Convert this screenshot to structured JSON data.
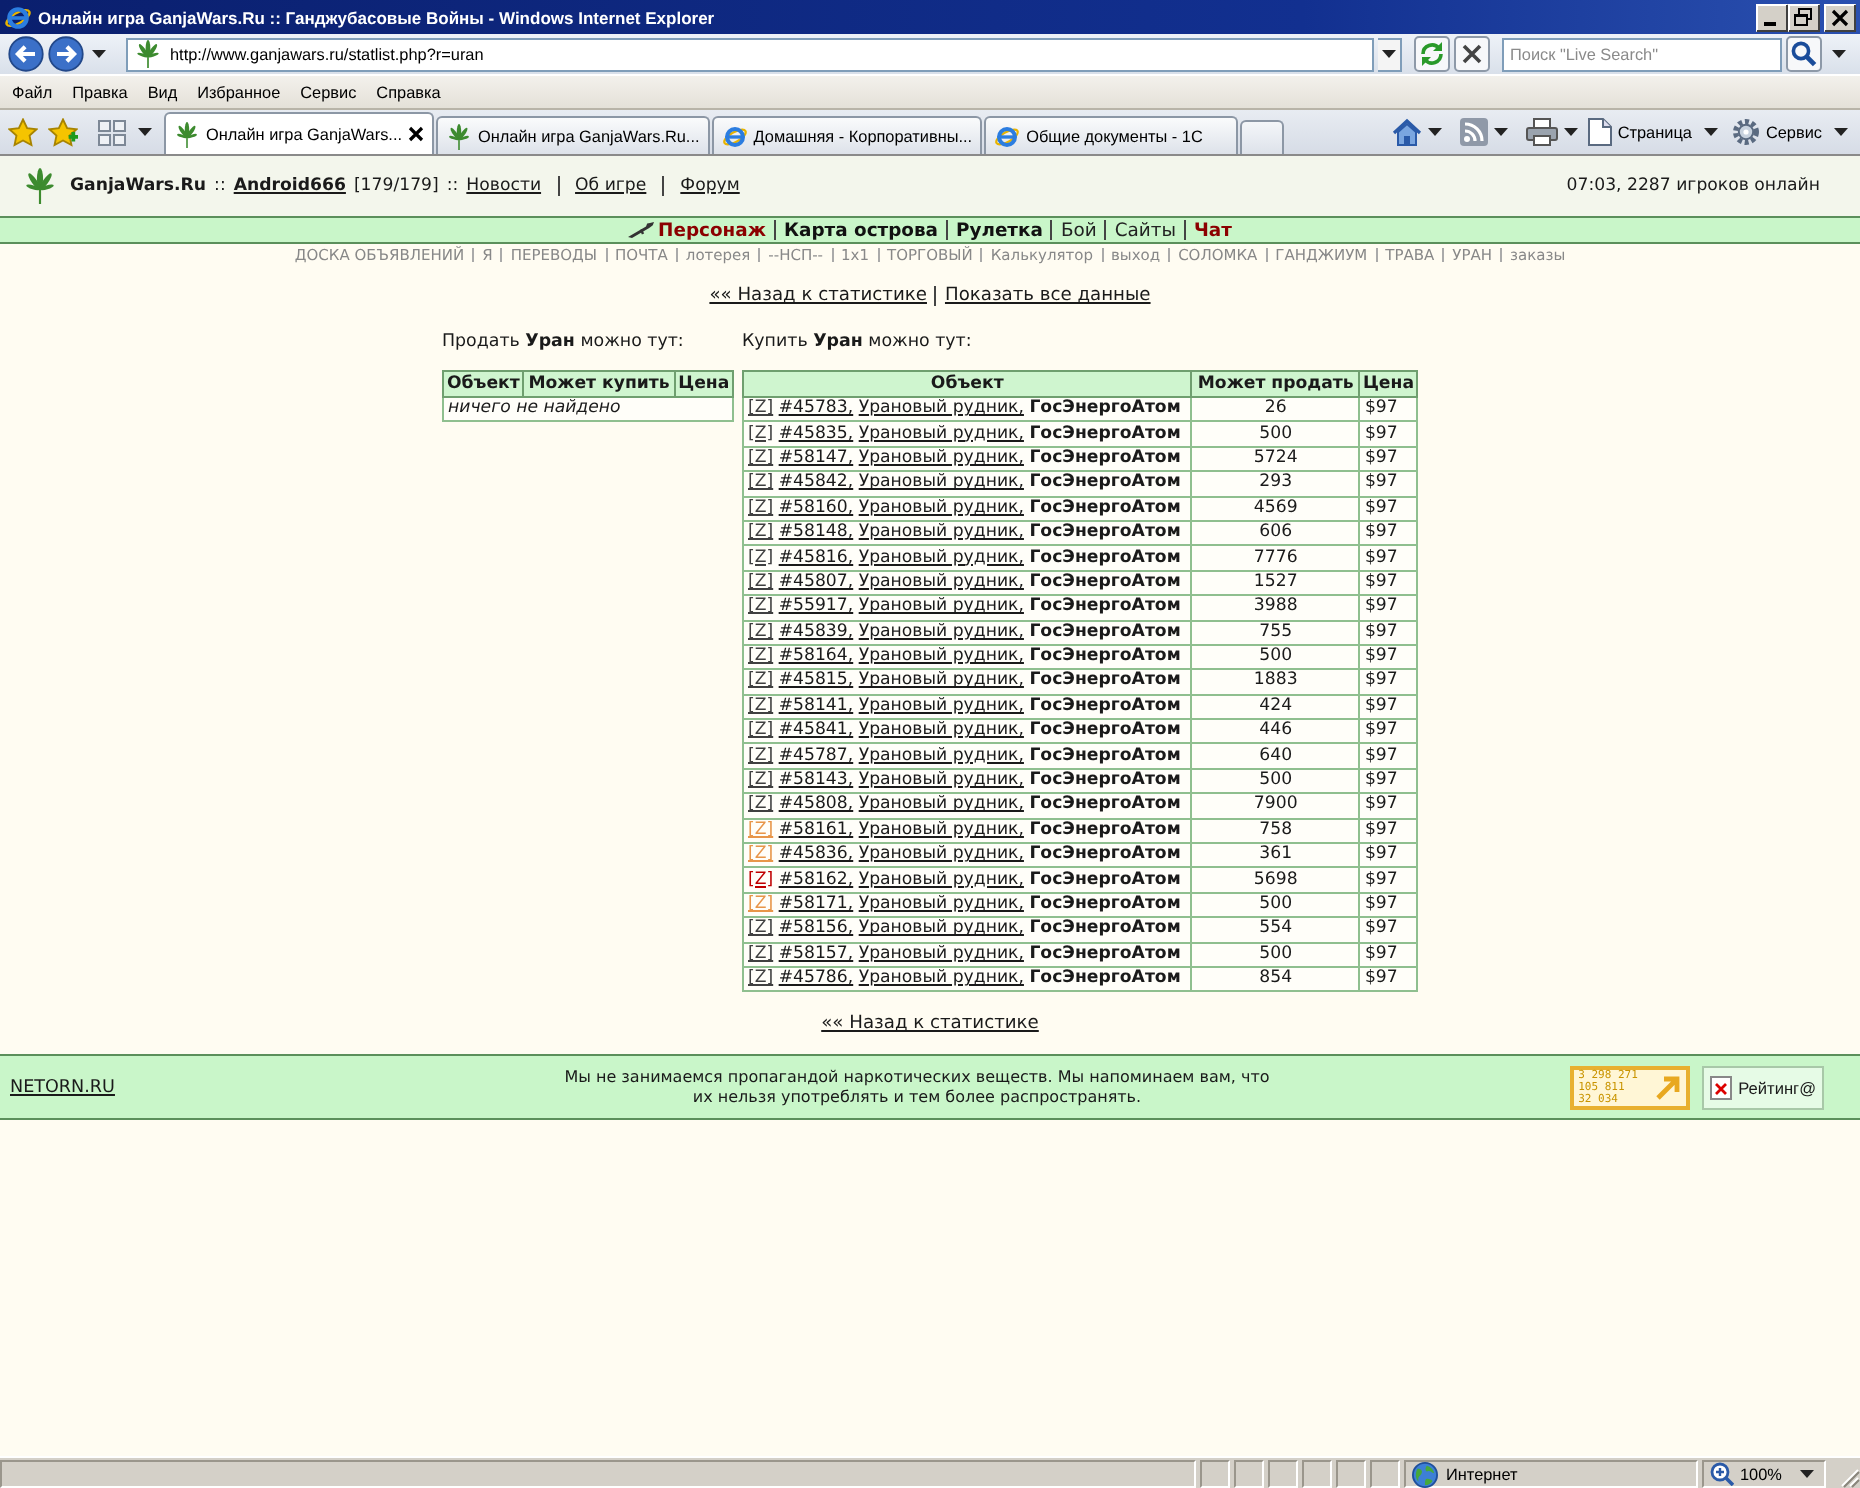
{
  "window": {
    "title": "Онлайн игра GanjaWars.Ru :: Ганджубасовые Войны - Windows Internet Explorer"
  },
  "address_bar": {
    "url": "http://www.ganjawars.ru/statlist.php?r=uran",
    "search_placeholder": "Поиск \"Live Search\""
  },
  "menu_bar": [
    "Файл",
    "Правка",
    "Вид",
    "Избранное",
    "Сервис",
    "Справка"
  ],
  "tabs": [
    {
      "label": "Онлайн игра GanjaWars...",
      "kind": "leaf",
      "selected": true
    },
    {
      "label": "Онлайн игра GanjaWars.Ru...",
      "kind": "leaf",
      "selected": false
    },
    {
      "label": "Домашняя - Корпоративны...",
      "kind": "browser",
      "selected": false
    },
    {
      "label": "Общие документы - 1С",
      "kind": "browser",
      "selected": false
    }
  ],
  "command_bar": [
    {
      "label": "Страница",
      "kind": "page"
    },
    {
      "label": "Сервис",
      "kind": "gear"
    }
  ],
  "site_header": {
    "items": [
      {
        "text": "GanjaWars.Ru",
        "kind": "brand"
      },
      {
        "text": "::",
        "kind": "text"
      },
      {
        "text": "Android666",
        "kind": "user"
      },
      {
        "text": "[179/179]",
        "kind": "text"
      },
      {
        "text": "::",
        "kind": "text"
      },
      {
        "text": "Новости",
        "kind": "link"
      },
      {
        "text": "Об игре",
        "kind": "link"
      },
      {
        "text": "Форум",
        "kind": "link"
      }
    ],
    "online": "07:03, 2287 игроков онлайн"
  },
  "main_nav": [
    {
      "label": "Персонаж",
      "kind": "accent"
    },
    {
      "label": "Карта острова",
      "kind": "bold"
    },
    {
      "label": "Рулетка",
      "kind": "bold"
    },
    {
      "label": "Бой",
      "kind": "plain"
    },
    {
      "label": "Сайты",
      "kind": "plain"
    },
    {
      "label": "Чат",
      "kind": "accent"
    }
  ],
  "sub_nav": [
    "ДОСКА ОБЪЯВЛЕНИЙ",
    "Я",
    "ПЕРЕВОДЫ",
    "ПОЧТА",
    "лотерея",
    "--НСП--",
    "1x1",
    "ТОРГОВЫЙ",
    "Калькулятор",
    "выход",
    "СОЛОМКА",
    "ГАНДЖИУМ",
    "ТРАВА",
    "УРАН",
    "заказы"
  ],
  "top_links": [
    "«« Назад к статистике",
    "Показать все данные"
  ],
  "market": {
    "sell": {
      "caption": "Продать **Уран** можно тут:",
      "columns": [
        "Объект",
        "Может купить",
        "Цена"
      ],
      "empty": "ничего не найдено"
    },
    "buy": {
      "caption": "Купить **Уран** можно тут:",
      "columns": [
        "Объект",
        "Может продать",
        "Цена"
      ],
      "rows": [
        {
          "tag": "[Z]",
          "color": "#404040",
          "id": "#45783,",
          "type": "Урановый рудник,",
          "owner": "ГосЭнергоАтом",
          "amount": "26",
          "price": "$97"
        },
        {
          "tag": "[Z]",
          "color": "#404040",
          "id": "#45835,",
          "type": "Урановый рудник,",
          "owner": "ГосЭнергоАтом",
          "amount": "500",
          "price": "$97"
        },
        {
          "tag": "[Z]",
          "color": "#404040",
          "id": "#58147,",
          "type": "Урановый рудник,",
          "owner": "ГосЭнергоАтом",
          "amount": "5724",
          "price": "$97"
        },
        {
          "tag": "[Z]",
          "color": "#404040",
          "id": "#45842,",
          "type": "Урановый рудник,",
          "owner": "ГосЭнергоАтом",
          "amount": "293",
          "price": "$97"
        },
        {
          "tag": "[Z]",
          "color": "#404040",
          "id": "#58160,",
          "type": "Урановый рудник,",
          "owner": "ГосЭнергоАтом",
          "amount": "4569",
          "price": "$97"
        },
        {
          "tag": "[Z]",
          "color": "#404040",
          "id": "#58148,",
          "type": "Урановый рудник,",
          "owner": "ГосЭнергоАтом",
          "amount": "606",
          "price": "$97"
        },
        {
          "tag": "[Z]",
          "color": "#404040",
          "id": "#45816,",
          "type": "Урановый рудник,",
          "owner": "ГосЭнергоАтом",
          "amount": "7776",
          "price": "$97"
        },
        {
          "tag": "[Z]",
          "color": "#404040",
          "id": "#45807,",
          "type": "Урановый рудник,",
          "owner": "ГосЭнергоАтом",
          "amount": "1527",
          "price": "$97"
        },
        {
          "tag": "[Z]",
          "color": "#404040",
          "id": "#55917,",
          "type": "Урановый рудник,",
          "owner": "ГосЭнергоАтом",
          "amount": "3988",
          "price": "$97"
        },
        {
          "tag": "[Z]",
          "color": "#404040",
          "id": "#45839,",
          "type": "Урановый рудник,",
          "owner": "ГосЭнергоАтом",
          "amount": "755",
          "price": "$97"
        },
        {
          "tag": "[Z]",
          "color": "#404040",
          "id": "#58164,",
          "type": "Урановый рудник,",
          "owner": "ГосЭнергоАтом",
          "amount": "500",
          "price": "$97"
        },
        {
          "tag": "[Z]",
          "color": "#404040",
          "id": "#45815,",
          "type": "Урановый рудник,",
          "owner": "ГосЭнергоАтом",
          "amount": "1883",
          "price": "$97"
        },
        {
          "tag": "[Z]",
          "color": "#404040",
          "id": "#58141,",
          "type": "Урановый рудник,",
          "owner": "ГосЭнергоАтом",
          "amount": "424",
          "price": "$97"
        },
        {
          "tag": "[Z]",
          "color": "#404040",
          "id": "#45841,",
          "type": "Урановый рудник,",
          "owner": "ГосЭнергоАтом",
          "amount": "446",
          "price": "$97"
        },
        {
          "tag": "[Z]",
          "color": "#404040",
          "id": "#45787,",
          "type": "Урановый рудник,",
          "owner": "ГосЭнергоАтом",
          "amount": "640",
          "price": "$97"
        },
        {
          "tag": "[Z]",
          "color": "#404040",
          "id": "#58143,",
          "type": "Урановый рудник,",
          "owner": "ГосЭнергоАтом",
          "amount": "500",
          "price": "$97"
        },
        {
          "tag": "[Z]",
          "color": "#404040",
          "id": "#45808,",
          "type": "Урановый рудник,",
          "owner": "ГосЭнергоАтом",
          "amount": "7900",
          "price": "$97"
        },
        {
          "tag": "[Z]",
          "color": "#e8964a",
          "id": "#58161,",
          "type": "Урановый рудник,",
          "owner": "ГосЭнергоАтом",
          "amount": "758",
          "price": "$97"
        },
        {
          "tag": "[Z]",
          "color": "#e8964a",
          "id": "#45836,",
          "type": "Урановый рудник,",
          "owner": "ГосЭнергоАтом",
          "amount": "361",
          "price": "$97"
        },
        {
          "tag": "[Z]",
          "color": "#c00000",
          "id": "#58162,",
          "type": "Урановый рудник,",
          "owner": "ГосЭнергоАтом",
          "amount": "5698",
          "price": "$97"
        },
        {
          "tag": "[Z]",
          "color": "#e8964a",
          "id": "#58171,",
          "type": "Урановый рудник,",
          "owner": "ГосЭнергоАтом",
          "amount": "500",
          "price": "$97"
        },
        {
          "tag": "[Z]",
          "color": "#404040",
          "id": "#58156,",
          "type": "Урановый рудник,",
          "owner": "ГосЭнергоАтом",
          "amount": "554",
          "price": "$97"
        },
        {
          "tag": "[Z]",
          "color": "#404040",
          "id": "#58157,",
          "type": "Урановый рудник,",
          "owner": "ГосЭнергоАтом",
          "amount": "500",
          "price": "$97"
        },
        {
          "tag": "[Z]",
          "color": "#404040",
          "id": "#45786,",
          "type": "Урановый рудник,",
          "owner": "ГосЭнергоАтом",
          "amount": "854",
          "price": "$97"
        }
      ]
    }
  },
  "bottom_link": "«« Назад к статистике",
  "footer": {
    "link": "NETORN.RU",
    "notice": "Мы не занимаемся пропагандой наркотических веществ. Мы напоминаем вам, что\nих нельзя употреблять и тем более распространять.",
    "counter": [
      "3 298 271",
      "105 811",
      "32 034"
    ],
    "rating": "Рейтинг@"
  },
  "status_bar": {
    "zone": "Интернет",
    "zoom": "100%"
  }
}
